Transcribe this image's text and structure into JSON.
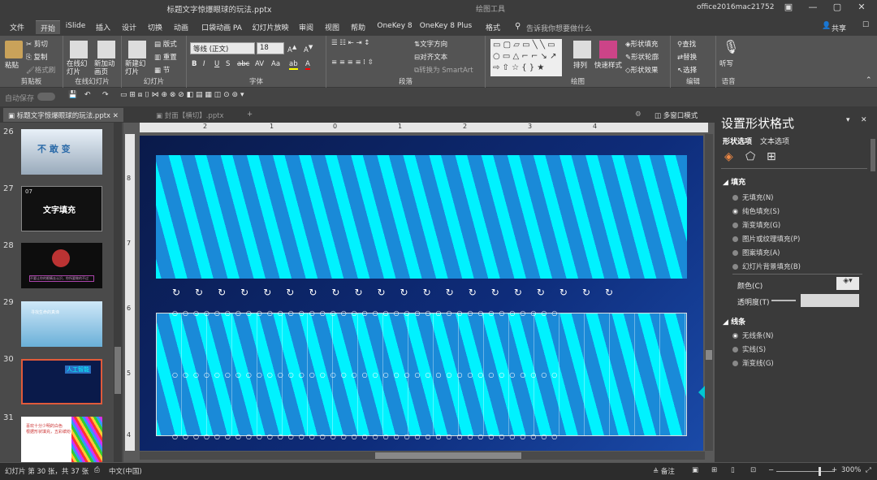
{
  "titlebar": {
    "doc_title": "标题文字惊爆眼球的玩法.pptx",
    "context_tab": "绘图工具",
    "user": "office2016mac21752"
  },
  "tabs": [
    "文件",
    "开始",
    "iSlide",
    "插入",
    "设计",
    "切换",
    "动画",
    "口袋动画 PA",
    "幻灯片放映",
    "审阅",
    "视图",
    "帮助",
    "OneKey 8",
    "OneKey 8 Plus",
    "格式"
  ],
  "tell_me": "告诉我你想要做什么",
  "share": "共享",
  "ribbon": {
    "clipboard": {
      "paste": "粘贴",
      "cut": "剪切",
      "copy": "复制",
      "painter": "格式刷",
      "label": "剪贴板"
    },
    "online": {
      "btn1": "在线幻灯片",
      "btn2": "新加动画页",
      "label": "在线幻灯片"
    },
    "slides": {
      "new": "新建幻灯片",
      "layout": "版式",
      "reset": "重置",
      "section": "节",
      "label": "幻灯片"
    },
    "font": {
      "name": "等线 (正文)",
      "size": "18",
      "label": "字体"
    },
    "paragraph": {
      "dir": "文字方向",
      "align": "对齐文本",
      "smartart": "转换为 SmartArt",
      "label": "段落"
    },
    "drawing": {
      "arrange": "排列",
      "quick": "快速样式",
      "fill": "形状填充",
      "outline": "形状轮廓",
      "effect": "形状效果",
      "label": "绘图"
    },
    "editing": {
      "find": "查找",
      "replace": "替换",
      "select": "选择",
      "label": "编辑"
    },
    "voice": {
      "listen": "听写",
      "label": "语音"
    }
  },
  "qat": {
    "autosave": "自动保存"
  },
  "doctabs": {
    "active": "标题文字惊爆眼球的玩法.pptx",
    "other": "封面【横切】.pptx",
    "multi": "多窗口模式"
  },
  "thumbnails": [
    {
      "num": "26",
      "text": "不 敢 变"
    },
    {
      "num": "27",
      "badge": "07",
      "text": "文字填充"
    },
    {
      "num": "28",
      "text": "不要让你的眼睛去认识，你所要做的不过"
    },
    {
      "num": "29",
      "text": "寻找生命的真谛"
    },
    {
      "num": "30",
      "text": "人工智能"
    },
    {
      "num": "31",
      "text": "喜欢十分少明的白色\n根据形状填充，五彩缤纷"
    }
  ],
  "pane": {
    "title": "设置形状格式",
    "tab1": "形状选项",
    "tab2": "文本选项",
    "fill_header": "填充",
    "fill_options": [
      "无填充(N)",
      "纯色填充(S)",
      "渐变填充(G)",
      "图片或纹理填充(P)",
      "图案填充(A)",
      "幻灯片背景填充(B)"
    ],
    "selected_fill": "纯色填充(S)",
    "color_label": "颜色(C)",
    "trans_label": "透明度(T)",
    "line_header": "线条",
    "line_options": [
      "无线条(N)",
      "实线(S)",
      "渐变线(G)"
    ]
  },
  "status": {
    "slide": "幻灯片 第 30 张，共 37 张",
    "lang": "中文(中国)",
    "notes": "备注",
    "zoom": "300%"
  },
  "ruler_top": [
    "2",
    "1",
    "0",
    "1",
    "2",
    "3",
    "4"
  ],
  "ruler_left": [
    "8",
    "7",
    "6",
    "5",
    "4"
  ],
  "colors": {
    "stripe": "#00f2ff",
    "slide_bg": "#0a1a4a",
    "box": "#1a8ad8",
    "accent": "#00c7d2"
  }
}
